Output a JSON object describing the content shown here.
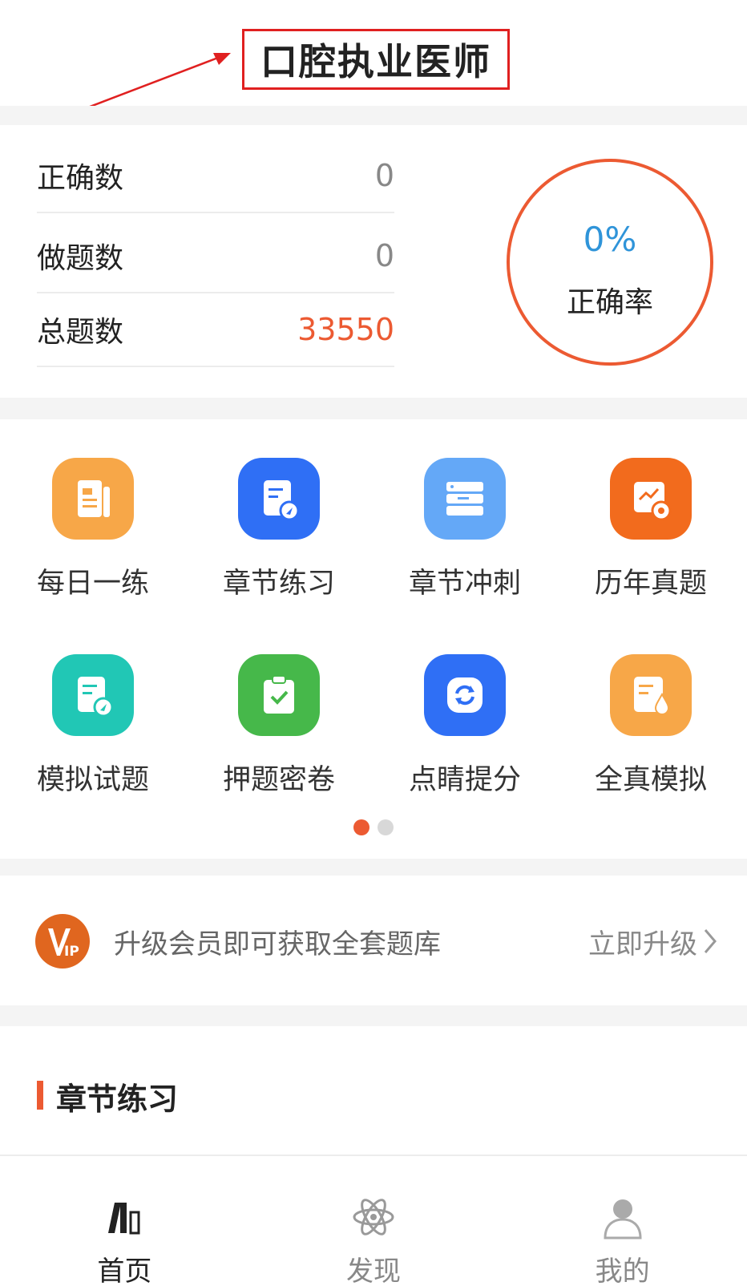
{
  "header": {
    "title": "口腔执业医师"
  },
  "stats": {
    "rows": [
      {
        "label": "正确数",
        "value": "0"
      },
      {
        "label": "做题数",
        "value": "0"
      },
      {
        "label": "总题数",
        "value": "33550"
      }
    ],
    "accuracy_value": "0%",
    "accuracy_label": "正确率",
    "colors": {
      "accent": "#ec5a32",
      "percent": "#2f94d9"
    }
  },
  "grid": {
    "items": [
      {
        "label": "每日一练",
        "icon": "daily-practice-icon",
        "color": "#f7a748"
      },
      {
        "label": "章节练习",
        "icon": "chapter-practice-icon",
        "color": "#2f6ff5"
      },
      {
        "label": "章节冲刺",
        "icon": "chapter-sprint-icon",
        "color": "#64a8f7"
      },
      {
        "label": "历年真题",
        "icon": "past-exams-icon",
        "color": "#f26b1d"
      },
      {
        "label": "模拟试题",
        "icon": "mock-exam-icon",
        "color": "#21c7b5"
      },
      {
        "label": "押题密卷",
        "icon": "predicted-paper-icon",
        "color": "#46b84a"
      },
      {
        "label": "点睛提分",
        "icon": "score-boost-icon",
        "color": "#2f6ff5"
      },
      {
        "label": "全真模拟",
        "icon": "full-simulation-icon",
        "color": "#f7a748"
      }
    ],
    "page_count": 2,
    "active_page": 1
  },
  "vip": {
    "text": "升级会员即可获取全套题库",
    "action": "立即升级",
    "badge_text": "IP",
    "badge_color": "#e0661f"
  },
  "section": {
    "title": "章节练习"
  },
  "tabbar": {
    "tabs": [
      {
        "label": "首页",
        "icon": "home-books-icon",
        "active": true
      },
      {
        "label": "发现",
        "icon": "atom-icon",
        "active": false
      },
      {
        "label": "我的",
        "icon": "user-icon",
        "active": false
      }
    ]
  }
}
